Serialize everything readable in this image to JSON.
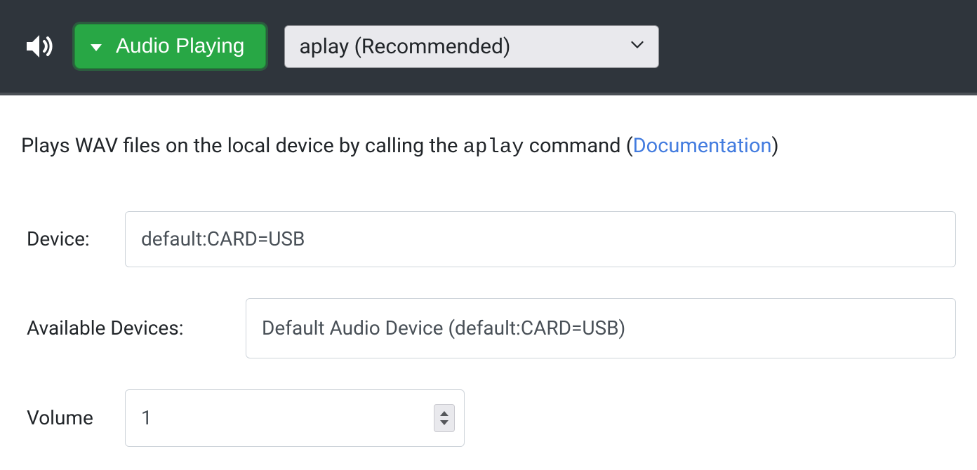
{
  "header": {
    "status_label": "Audio Playing",
    "player_selected": "aplay (Recommended)"
  },
  "description": {
    "prefix": "Plays WAV files on the local device by calling the ",
    "command": "aplay",
    "middle": " command (",
    "link_text": "Documentation",
    "suffix": ")"
  },
  "form": {
    "device_label": "Device:",
    "device_value": "default:CARD=USB",
    "available_label": "Available Devices:",
    "available_value": "Default Audio Device (default:CARD=USB)",
    "volume_label": "Volume",
    "volume_value": "1"
  }
}
